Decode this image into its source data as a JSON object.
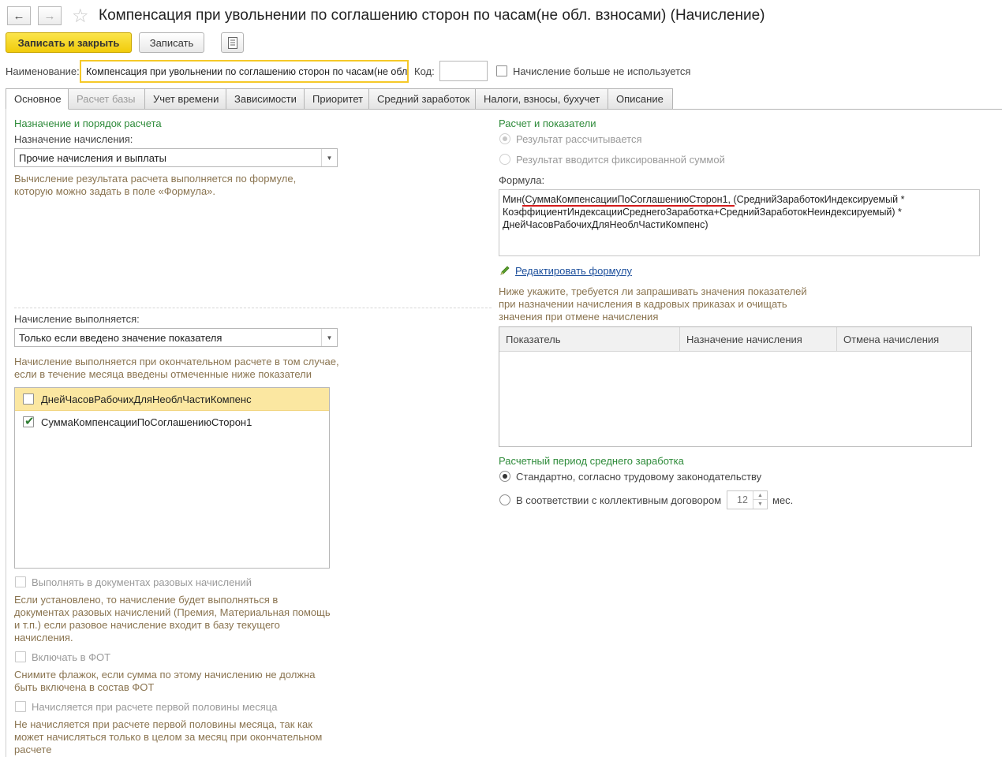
{
  "window": {
    "title": "Компенсация при увольнении по соглашению сторон по часам(не обл. взносами) (Начисление)"
  },
  "toolbar": {
    "save_close_label": "Записать и закрыть",
    "save_label": "Записать"
  },
  "header": {
    "name_label": "Наименование:",
    "name_value": "Компенсация при увольнении по соглашению сторон по часам(не обл. взносами)",
    "code_label": "Код:",
    "code_value": "",
    "not_used_label": "Начисление больше не используется",
    "not_used_checked": false
  },
  "tabs": [
    {
      "label": "Основное",
      "active": true,
      "enabled": true
    },
    {
      "label": "Расчет базы",
      "active": false,
      "enabled": false
    },
    {
      "label": "Учет времени",
      "active": false,
      "enabled": true
    },
    {
      "label": "Зависимости",
      "active": false,
      "enabled": true
    },
    {
      "label": "Приоритет",
      "active": false,
      "enabled": true
    },
    {
      "label": "Средний заработок",
      "active": false,
      "enabled": true
    },
    {
      "label": "Налоги, взносы, бухучет",
      "active": false,
      "enabled": true
    },
    {
      "label": "Описание",
      "active": false,
      "enabled": true
    }
  ],
  "left": {
    "section_title": "Назначение и порядок расчета",
    "purpose_label": "Назначение начисления:",
    "purpose_value": "Прочие начисления и выплаты",
    "purpose_hint": "Вычисление результата расчета выполняется по формуле, которую можно задать в поле «Формула».",
    "execution_label": "Начисление выполняется:",
    "execution_value": "Только если введено значение показателя",
    "execution_hint": "Начисление выполняется при окончательном расчете в том случае, если в течение месяца введены отмеченные ниже показатели",
    "indicators": [
      {
        "name": "ДнейЧасовРабочихДляНеоблЧастиКомпенс",
        "checked": false,
        "selected": true
      },
      {
        "name": "СуммаКомпенсацииПоСоглашениюСторон1",
        "checked": true,
        "selected": false
      }
    ],
    "one_time_label": "Выполнять в документах разовых начислений",
    "one_time_hint": "Если установлено, то начисление будет выполняться в документах разовых начислений (Премия, Материальная помощь и т.п.) если разовое начисление входит в базу текущего начисления.",
    "fot_label": "Включать в ФОТ",
    "fot_hint": "Снимите флажок, если сумма по этому начислению не должна быть включена в состав ФОТ",
    "first_half_label": "Начисляется при расчете первой половины месяца",
    "first_half_hint": "Не начисляется при расчете первой половины месяца, так как может начисляться только в целом за месяц при окончательном расчете"
  },
  "right": {
    "section_title": "Расчет и показатели",
    "radio_calculated": "Результат рассчитывается",
    "radio_fixed": "Результат вводится фиксированной суммой",
    "formula_label": "Формула:",
    "formula_prefix": "Мин(",
    "formula_highlight": "СуммаКомпенсацииПоСоглашениюСторон1",
    "formula_line1_rest": ", (СреднийЗаработокИндексируемый *",
    "formula_line2": "КоэффициентИндексацииСреднегоЗаработка+СреднийЗаработокНеиндексируемый) *",
    "formula_line3": "ДнейЧасовРабочихДляНеоблЧастиКомпенс)",
    "edit_formula_link": "Редактировать формулу",
    "indicators_hint": "Ниже укажите, требуется ли запрашивать значения показателей при назначении начисления в кадровых приказах и очищать значения при отмене начисления",
    "table_columns": [
      "Показатель",
      "Назначение начисления",
      "Отмена начисления"
    ],
    "avg_section_title": "Расчетный период среднего заработка",
    "avg_standard": "Стандартно, согласно трудовому законодательству",
    "avg_collective": "В соответствии с коллективным договором",
    "avg_months_value": "12",
    "avg_months_unit": "мес."
  },
  "colors": {
    "accent_yellow": "#f5d31e",
    "section_green": "#2e8b3a",
    "hint_brown": "#8a7450",
    "link_blue": "#1c4f9c",
    "underline_red": "#d31b1b"
  }
}
